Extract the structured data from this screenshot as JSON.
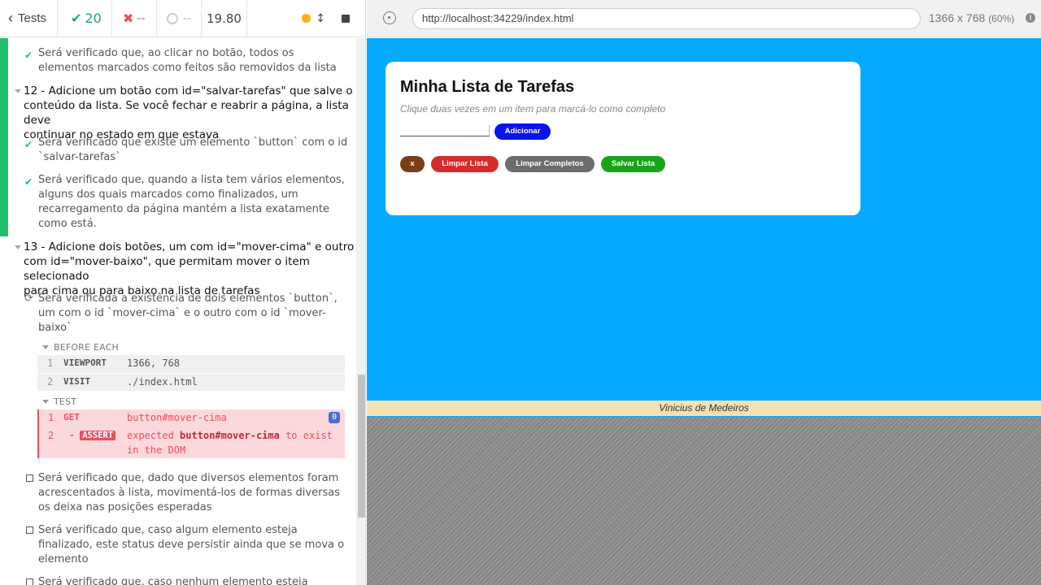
{
  "header": {
    "tests_label": "Tests",
    "passed_count": "20",
    "failed_count": "--",
    "pending_count": "--",
    "duration": "19.80"
  },
  "reporter": {
    "items": [
      {
        "text_lines": [
          "Será verificado que, ao clicar no botão, todos os",
          "elementos marcados como feitos são removidos da lista"
        ]
      },
      {
        "suite_lines": [
          "12 - Adicione um botão com id=\"salvar-tarefas\" que salve o",
          "conteúdo da lista. Se você fechar e reabrir a página, a lista deve",
          "continuar no estado em que estava"
        ]
      },
      {
        "text_lines": [
          "Será verificado que existe um elemento `button` com o id",
          "`salvar-tarefas`"
        ]
      },
      {
        "text_lines": [
          "Será verificado que, quando a lista tem vários elementos,",
          "alguns dos quais marcados como finalizados, um",
          "recarregamento da página mantém a lista exatamente",
          "como está."
        ]
      },
      {
        "suite_lines": [
          "13 - Adicione dois botões, um com id=\"mover-cima\" e outro",
          "com id=\"mover-baixo\", que permitam mover o item selecionado",
          "para cima ou para baixo na lista de tarefas"
        ]
      },
      {
        "text_lines": [
          "Será verificada a existência de dois elementos `button`,",
          "um com o id `mover-cima` e o outro com o id `mover-",
          "baixo`"
        ]
      },
      {
        "text_lines": [
          "Será verificado que, dado que diversos elementos foram",
          "acrescentados à lista, movimentá-los de formas diversas",
          "os deixa nas posições esperadas"
        ]
      },
      {
        "text_lines": [
          "Será verificado que, caso algum elemento esteja",
          "finalizado, este status deve persistir ainda que se mova o",
          "elemento"
        ]
      },
      {
        "text_lines": [
          "Será verificado que, caso nenhum elemento esteja"
        ]
      }
    ],
    "before_each_label": "BEFORE EACH",
    "test_label": "TEST",
    "before_commands": [
      {
        "num": "1",
        "name": "VIEWPORT",
        "msg": "1366, 768"
      },
      {
        "num": "2",
        "name": "VISIT",
        "msg": "./index.html"
      }
    ],
    "test_commands": {
      "get": {
        "num": "1",
        "name": "GET",
        "msg": "button#mover-cima",
        "count": "0"
      },
      "assert": {
        "num": "2",
        "prefix": "-",
        "name": "ASSERT",
        "msg_pre": "expected ",
        "msg_bold": "button#mover-cima",
        "msg_post": " to exist",
        "msg_line2": "in the DOM"
      }
    }
  },
  "browser": {
    "url": "http://localhost:34229/index.html",
    "viewport": "1366 x 768",
    "scale": "(60%)"
  },
  "app": {
    "title": "Minha Lista de Tarefas",
    "subtitle": "Clique duas vezes em um item para marcá-lo como completo",
    "add_button": "Adicionar",
    "buttons": [
      {
        "label": "x",
        "color": "#7a3f14"
      },
      {
        "label": "Limpar Lista",
        "color": "#d92b2b"
      },
      {
        "label": "Limpar Completos",
        "color": "#6c6c6c"
      },
      {
        "label": "Salvar Lista",
        "color": "#17a516"
      }
    ],
    "add_color": "#0a12ef",
    "footer": "Vinicius de Medeiros"
  }
}
